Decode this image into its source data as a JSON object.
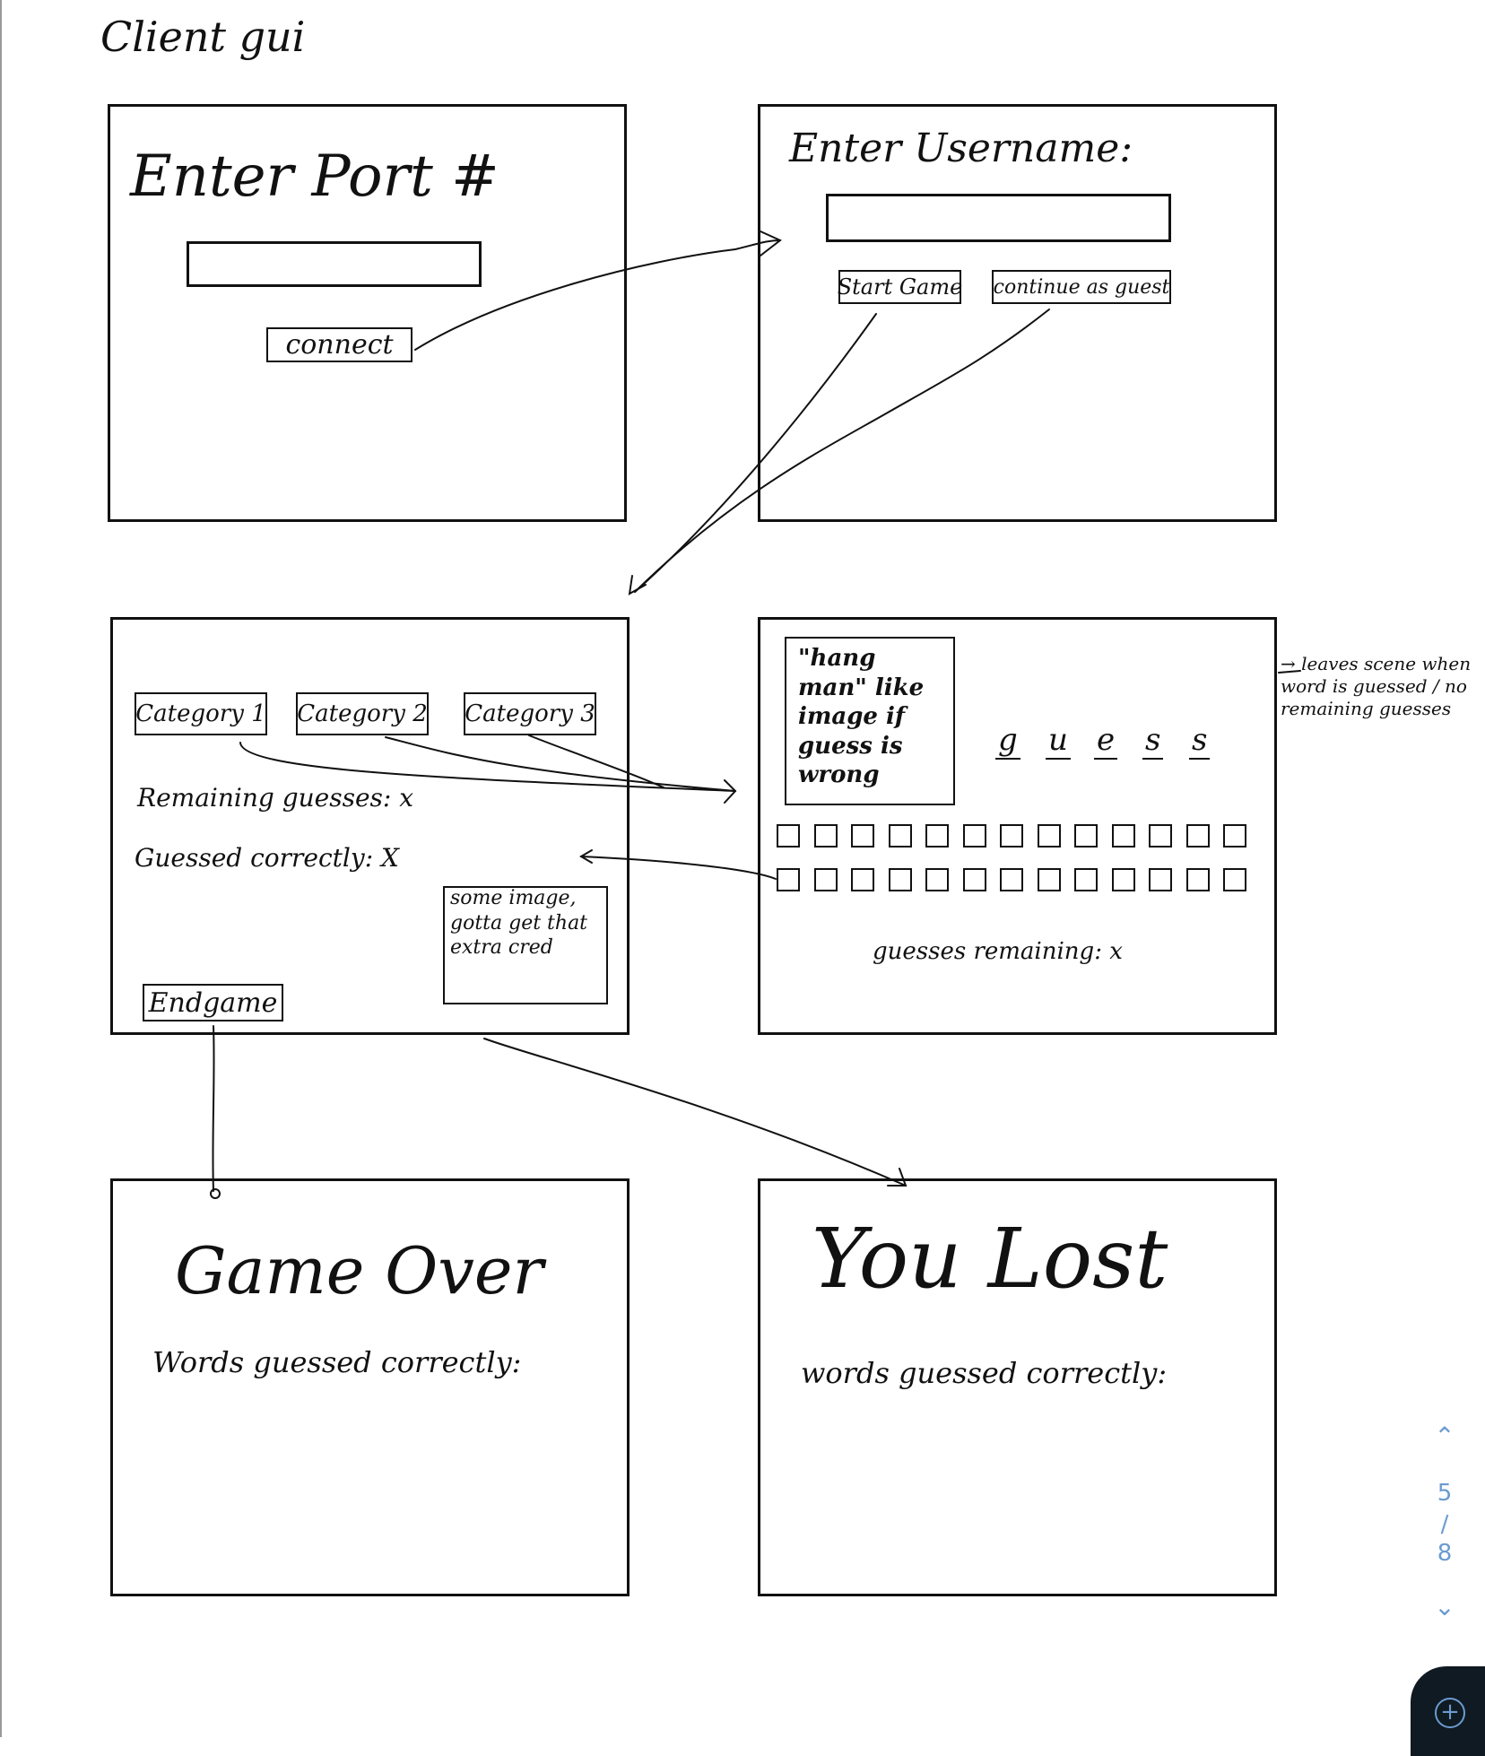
{
  "title": "Client gui",
  "screen_port": {
    "heading": "Enter Port #",
    "connect_label": "connect"
  },
  "screen_username": {
    "heading": "Enter Username:",
    "start_label": "Start Game",
    "guest_label": "continue as guest"
  },
  "screen_categories": {
    "categories": [
      "Category 1",
      "Category 2",
      "Category 3"
    ],
    "remaining": "Remaining guesses: x",
    "guessed": "Guessed correctly: X",
    "image_note": "some image, gotta get that extra cred",
    "endgame_label": "Endgame"
  },
  "screen_game": {
    "hangman_note": "\"hang man\" like image if guess is wrong",
    "word_letters": [
      "g",
      "u",
      "e",
      "s",
      "s"
    ],
    "guesses_remaining": "guesses remaining: x",
    "side_note": "→ leaves scene when word is guessed / no remaining guesses"
  },
  "screen_gameover": {
    "heading": "Game Over",
    "subtext": "Words guessed correctly:"
  },
  "screen_lost": {
    "heading": "You Lost",
    "subtext": "words guessed correctly:"
  },
  "pager": {
    "current": "5",
    "separator": "/",
    "total": "8"
  },
  "colors": {
    "ink": "#111111",
    "accent": "#6b9bd0",
    "fab_bg": "#0f1a22"
  },
  "icons": {
    "up": "chevron-up-icon",
    "down": "chevron-down-icon",
    "add": "plus-circle-icon"
  }
}
